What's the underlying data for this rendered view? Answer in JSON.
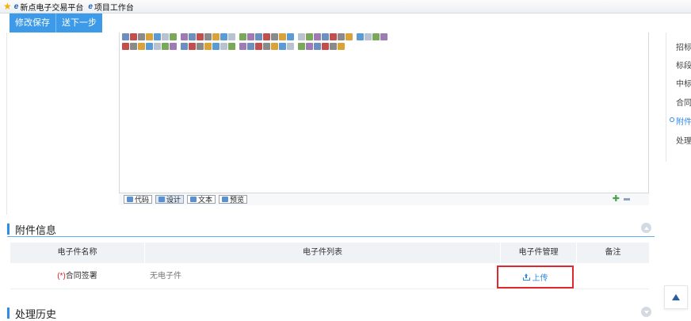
{
  "browser": {
    "favorites_icon": "favorites-star-icon",
    "tabs": [
      {
        "label": "新点电子交易平台",
        "icon": "ie-icon"
      },
      {
        "label": "项目工作台",
        "icon": "ie-icon"
      }
    ]
  },
  "toolbar": {
    "save_label": "修改保存",
    "next_label": "送下一步",
    "accent": "#3c9ae8"
  },
  "editor": {
    "modes": [
      {
        "label": "代码",
        "icon": "code-icon"
      },
      {
        "label": "设计",
        "icon": "design-icon"
      },
      {
        "label": "文本",
        "icon": "text-icon"
      },
      {
        "label": "预览",
        "icon": "preview-icon"
      }
    ]
  },
  "right_nav": {
    "items": [
      "招标",
      "标段",
      "中标",
      "合同",
      "附件",
      "处理"
    ],
    "active": "附件"
  },
  "attachments": {
    "title": "附件信息",
    "columns": [
      "电子件名称",
      "电子件列表",
      "电子件管理",
      "备注"
    ],
    "rows": [
      {
        "required_mark": "(*)",
        "name": "合同签署",
        "files": "无电子件",
        "action": "上传",
        "note": ""
      }
    ]
  },
  "history": {
    "title": "处理历史"
  },
  "colors": {
    "accent_blue": "#2f8be6",
    "highlight_red": "#e0282e",
    "required_red": "#e02020"
  }
}
